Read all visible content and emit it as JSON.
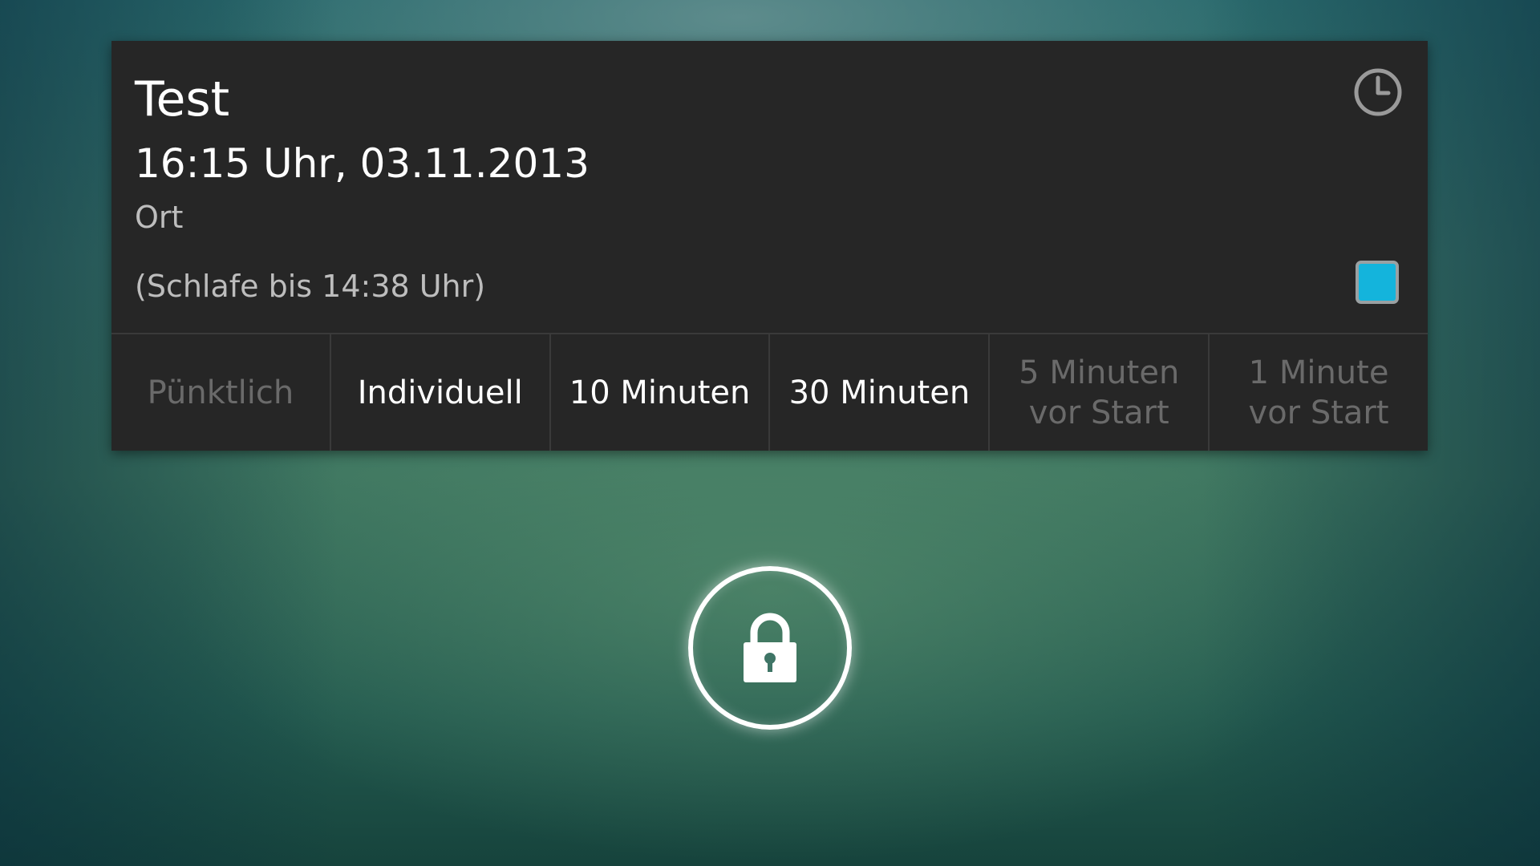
{
  "event": {
    "title": "Test",
    "datetime": "16:15 Uhr, 03.11.2013",
    "location": "Ort",
    "snooze_info": "(Schlafe bis 14:38 Uhr)",
    "color": "#14b4dc",
    "clock_icon": "clock-icon"
  },
  "snooze_options": [
    {
      "label": "Pünktlich",
      "enabled": false
    },
    {
      "label": "Individuell",
      "enabled": true
    },
    {
      "label": "10 Minuten",
      "enabled": true
    },
    {
      "label": "30 Minuten",
      "enabled": true
    },
    {
      "label": "5 Minuten vor Start",
      "enabled": false
    },
    {
      "label": "1 Minute vor Start",
      "enabled": false
    }
  ],
  "lock": {
    "icon": "lock-icon"
  }
}
